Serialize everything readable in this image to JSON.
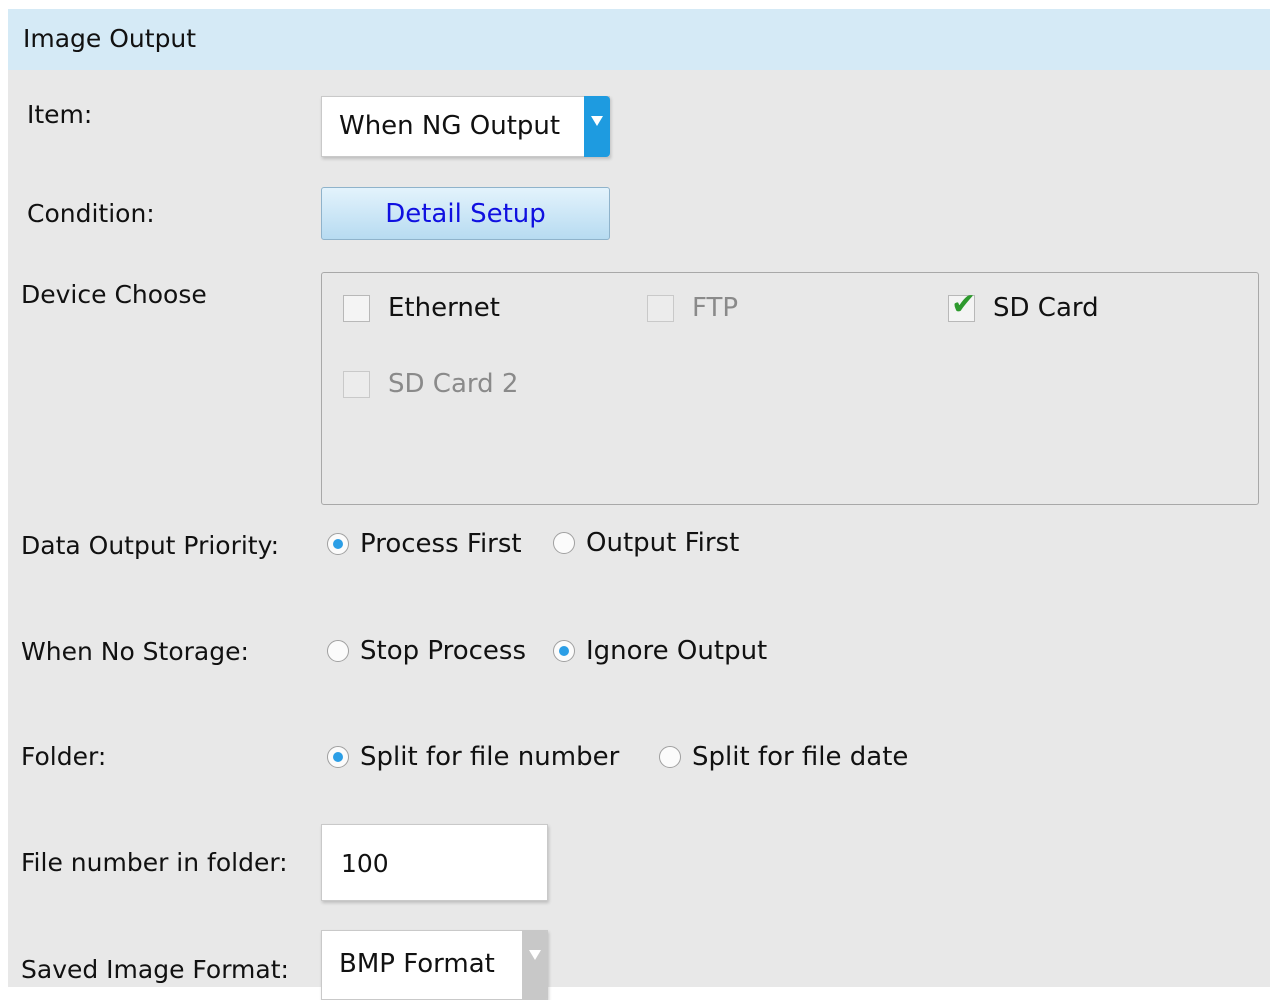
{
  "panel": {
    "title": "Image Output"
  },
  "item": {
    "label": "Item:",
    "value": "When NG Output"
  },
  "condition": {
    "label": "Condition:",
    "button_label": "Detail Setup"
  },
  "device_choose": {
    "label": "Device Choose",
    "options": [
      {
        "label": "Ethernet",
        "checked": false,
        "enabled": true
      },
      {
        "label": "FTP",
        "checked": false,
        "enabled": false
      },
      {
        "label": "SD Card",
        "checked": true,
        "enabled": true
      },
      {
        "label": "SD Card 2",
        "checked": false,
        "enabled": false
      }
    ],
    "check_mark": "✔"
  },
  "data_output_priority": {
    "label": "Data Output Priority:",
    "options": [
      {
        "label": "Process First",
        "selected": true
      },
      {
        "label": "Output First",
        "selected": false
      }
    ]
  },
  "when_no_storage": {
    "label": "When No Storage:",
    "options": [
      {
        "label": "Stop Process",
        "selected": false
      },
      {
        "label": "Ignore Output",
        "selected": true
      }
    ]
  },
  "folder": {
    "label": "Folder:",
    "options": [
      {
        "label": "Split for file number",
        "selected": true
      },
      {
        "label": "Split for file date",
        "selected": false
      }
    ]
  },
  "file_number": {
    "label": "File number in folder:",
    "value": "100"
  },
  "saved_image_format": {
    "label": "Saved Image Format:",
    "value": "BMP  Format"
  },
  "colors": {
    "header_bg": "#d5eaf6",
    "panel_bg": "#e8e8e8",
    "accent_blue": "#1e9be0",
    "button_text": "#1010e0",
    "check_green": "#2e9a2e"
  }
}
